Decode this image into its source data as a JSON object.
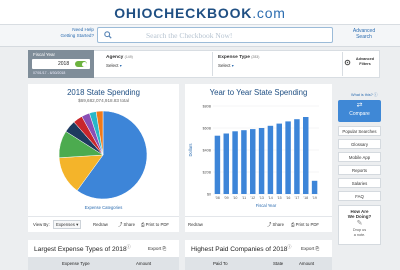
{
  "header": {
    "logo_main": "OHIOCHECKBOOK",
    "logo_domain": ".com"
  },
  "search": {
    "help_line1": "Need Help",
    "help_line2": "Getting Started?",
    "placeholder": "Search the Checkbook Now!",
    "advanced_line1": "Advanced",
    "advanced_line2": "Search"
  },
  "filters": {
    "fiscal_year_label": "Fiscal Year",
    "fiscal_year_value": "2018",
    "fiscal_year_range": "07/01/17 - 6/30/2018",
    "agency_label": "Agency",
    "agency_count": "(149)",
    "agency_select": "Select",
    "expense_label": "Expense Type",
    "expense_count": "(283)",
    "expense_select": "Select",
    "advanced_line1": "Advanced",
    "advanced_line2": "Filters"
  },
  "pie_panel": {
    "title": "2018 State Spending",
    "total": "$69,682,074,918.83 total",
    "subtitle": "Expense Categories",
    "view_by_label": "View By:",
    "view_by_value": "Expenses",
    "redraw": "Redraw",
    "share": "Share",
    "print": "Print to PDF"
  },
  "bar_panel": {
    "title": "Year to Year State Spending",
    "xlabel": "Fiscal Year",
    "ylabel": "Dollars",
    "redraw": "Redraw",
    "share": "Share",
    "print": "Print to PDF"
  },
  "chart_data": [
    {
      "type": "pie",
      "title": "2018 State Spending",
      "subtitle": "Expense Categories",
      "slices": [
        {
          "value": 60.0,
          "color": "#3d85d8"
        },
        {
          "value": 14.0,
          "color": "#f4b42a"
        },
        {
          "value": 10.0,
          "color": "#4cab4f"
        },
        {
          "value": 4.5,
          "color": "#1e3a5f"
        },
        {
          "value": 3.5,
          "color": "#c8262c"
        },
        {
          "value": 3.0,
          "color": "#8a4fb5"
        },
        {
          "value": 2.5,
          "color": "#29b8c9"
        },
        {
          "value": 2.5,
          "color": "#f07a1a"
        }
      ]
    },
    {
      "type": "bar",
      "title": "Year to Year State Spending",
      "xlabel": "Fiscal Year",
      "ylabel": "Dollars",
      "categories": [
        "'08",
        "'09",
        "'10",
        "'11",
        "'12",
        "'13",
        "'14",
        "'15",
        "'16",
        "'17",
        "'18",
        "'19"
      ],
      "values": [
        53,
        55,
        57,
        58,
        59,
        60,
        62,
        64,
        66,
        68,
        70,
        12
      ],
      "yticks": [
        "$0",
        "$20B",
        "$40B",
        "$60B",
        "$80B"
      ],
      "ylim": [
        0,
        80
      ],
      "color": "#3d85d8"
    }
  ],
  "sidebar": {
    "whats_this": "What is this?",
    "compare": "Compare",
    "buttons": [
      "Popular Searches",
      "Glossary",
      "Mobile App",
      "Reports",
      "Salaries",
      "FAQ"
    ],
    "feedback_title_line1": "How Are",
    "feedback_title_line2": "We Doing?",
    "feedback_action_line1": "Drop us",
    "feedback_action_line2": "a note."
  },
  "tables": {
    "left_title": "Largest Expense Types of 2018",
    "left_export": "Export",
    "left_col1": "Expense Type",
    "left_col2": "Amount",
    "right_title": "Highest Paid Companies of 2018",
    "right_export": "Export",
    "right_col1": "Paid To",
    "right_col2": "State",
    "right_col3": "Amount"
  },
  "colors": {
    "brand": "#1f4f83",
    "link": "#2b6cb0",
    "bar": "#3d85d8",
    "toggle": "#6db33f",
    "compare_button": "#3f88d6"
  }
}
